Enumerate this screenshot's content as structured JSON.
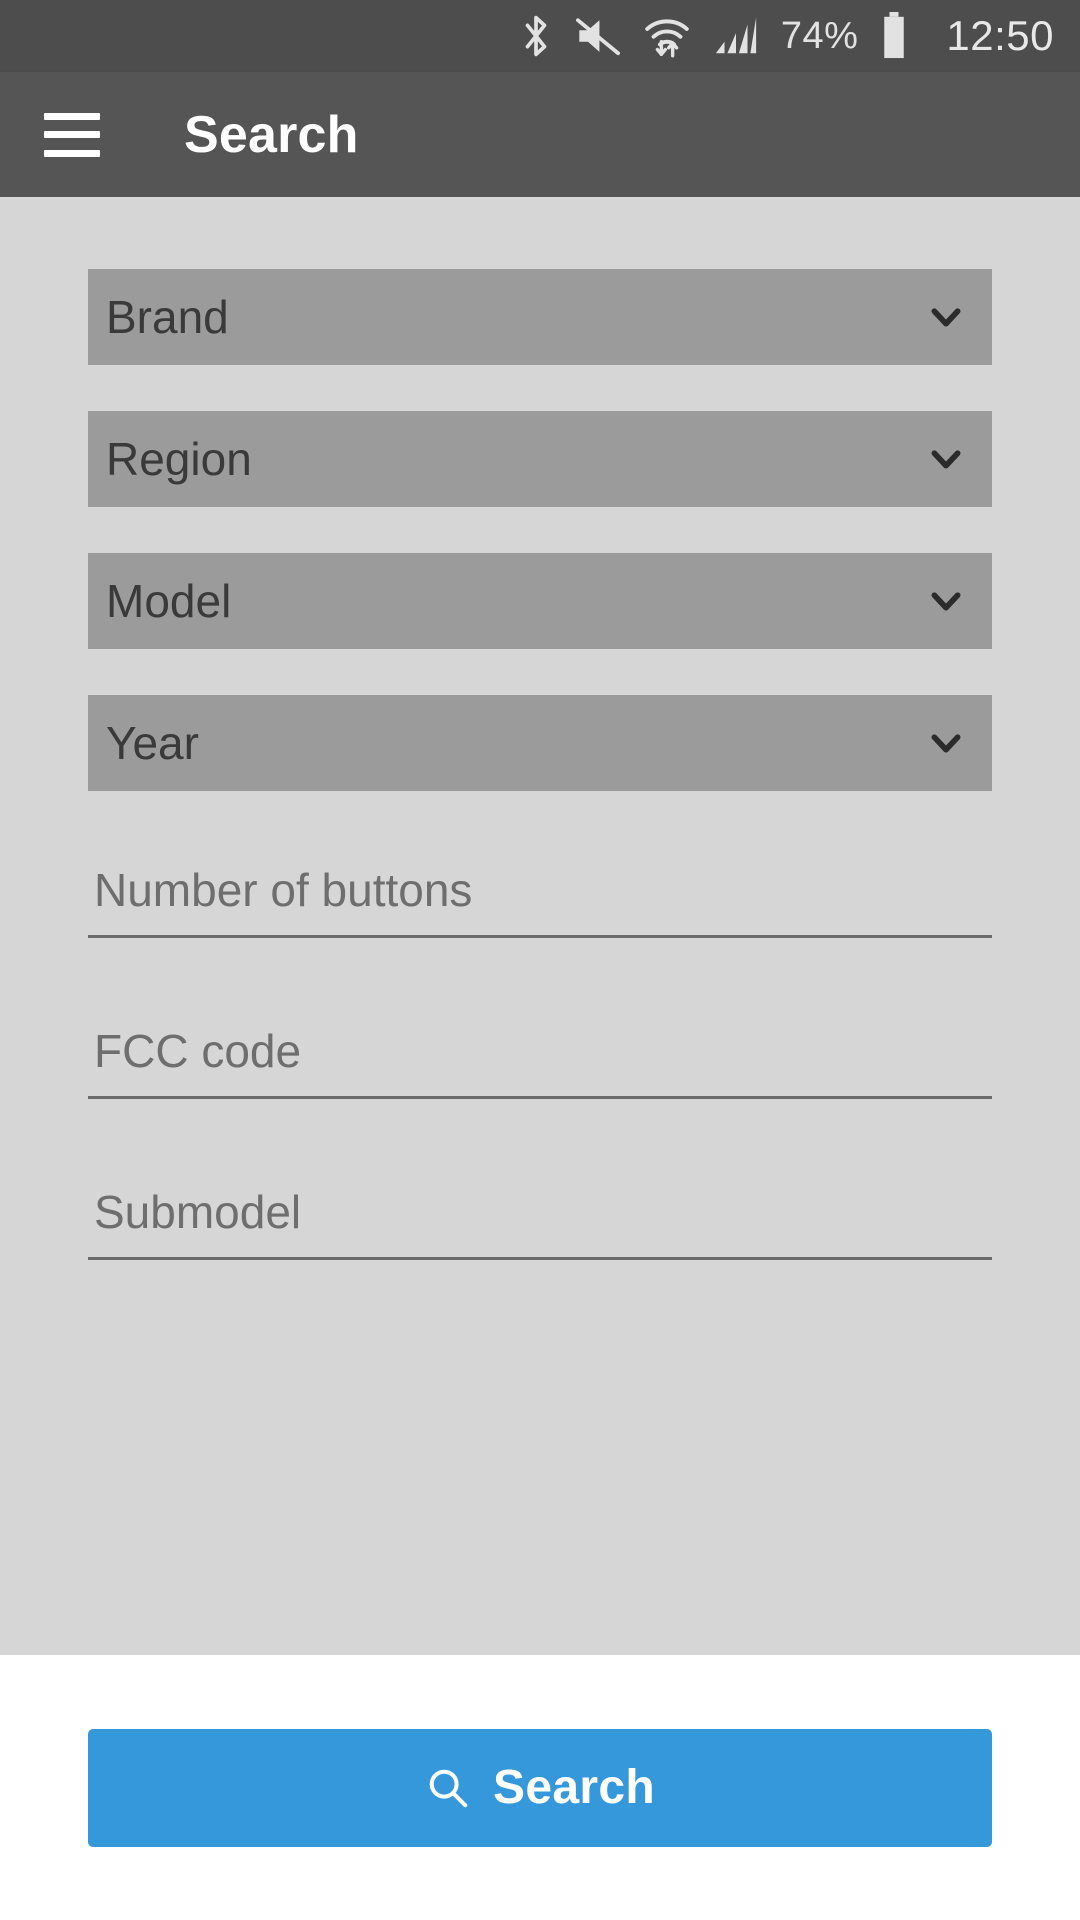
{
  "status_bar": {
    "icons": [
      "bluetooth-icon",
      "volume-muted-icon",
      "wifi-data-transfer-icon",
      "cellular-signal-icon"
    ],
    "battery_percent": "74%",
    "clock": "12:50",
    "background_color": "#4d4d4d",
    "text_color": "#e8e8e8"
  },
  "app_bar": {
    "menu_icon": "hamburger-menu-icon",
    "title": "Search",
    "background_color": "#555555",
    "title_color": "#ffffff"
  },
  "form": {
    "background_color": "#d6d6d6",
    "selects": [
      {
        "label": "Brand",
        "icon": "chevron-down-icon"
      },
      {
        "label": "Region",
        "icon": "chevron-down-icon"
      },
      {
        "label": "Model",
        "icon": "chevron-down-icon"
      },
      {
        "label": "Year",
        "icon": "chevron-down-icon"
      }
    ],
    "select_background_color": "#9b9b9b",
    "select_text_color": "#3a3a3a",
    "inputs": [
      {
        "placeholder": "Number of buttons",
        "value": ""
      },
      {
        "placeholder": "FCC code",
        "value": ""
      },
      {
        "placeholder": "Submodel",
        "value": ""
      }
    ],
    "input_text_color": "#6e6e6e",
    "input_underline_color": "#6b6b6b"
  },
  "footer": {
    "background_color": "#ffffff",
    "search_button": {
      "label": "Search",
      "icon": "search-magnifier-icon",
      "background_color": "#3598db",
      "text_color": "#ffffff"
    }
  }
}
